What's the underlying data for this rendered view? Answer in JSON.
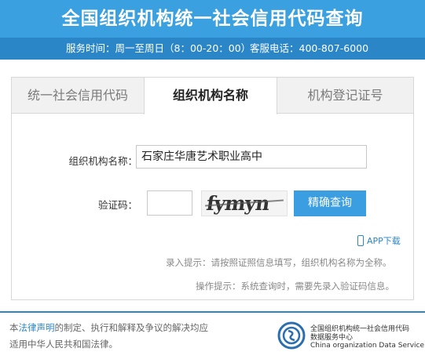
{
  "header": {
    "title": "全国组织机构统一社会信用代码查询",
    "service_hours": "服务时间：周一至周日（8：00-20：00）",
    "service_phone": "客服电话：400-807-6000"
  },
  "tabs": [
    {
      "label": "统一社会信用代码"
    },
    {
      "label": "组织机构名称"
    },
    {
      "label": "机构登记证号"
    }
  ],
  "form": {
    "org_name_label": "组织机构名称：",
    "org_name_value": "石家庄华唐艺术职业高中",
    "code_label": "验证码：",
    "code_value": "",
    "captcha_text": "fymyn",
    "query_button": "精确查询"
  },
  "app_link": "APP下载",
  "hints": {
    "entry": "录入提示：请按照证照信息填写，组织机构名称为全称。",
    "operation": "操作提示：系统查询时，需要先录入验证码信息。"
  },
  "footer": {
    "legal_prefix": "本",
    "legal_link": "法律声明",
    "legal_suffix": "的制定、执行和解释及争议的解决均应",
    "legal_line2": "适用中华人民共和国法律。",
    "logo_line1": "全国组织机构统一社会信用代码",
    "logo_line2": "数据服务中心",
    "logo_line3": "China organization Data Service"
  },
  "colors": {
    "header_bg": "#3aa0e0",
    "subbar_bg": "#2b86c8",
    "button_bg": "#3a9ee0"
  },
  "icons": [
    "phone-icon",
    "logo-icon"
  ]
}
